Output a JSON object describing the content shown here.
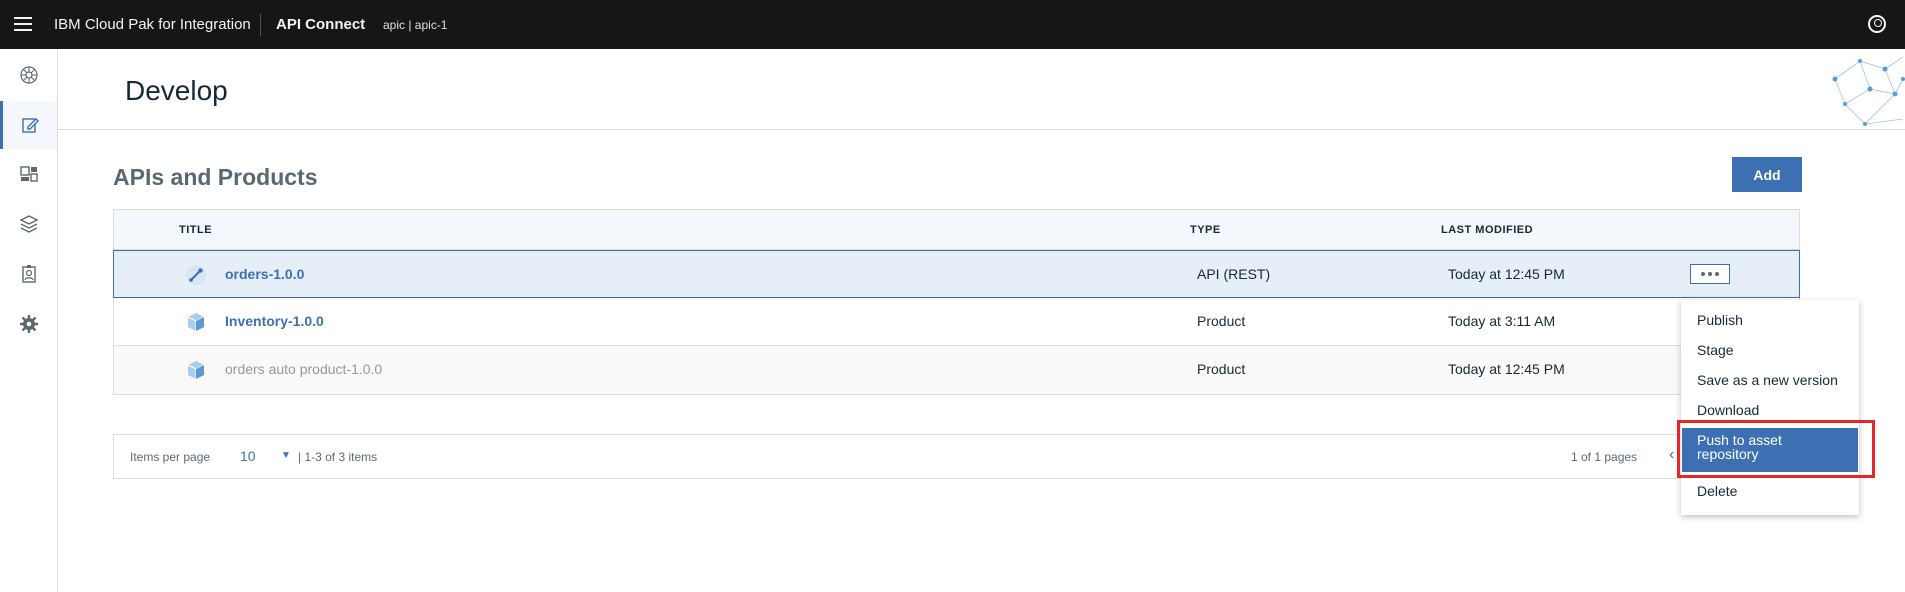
{
  "header": {
    "brand": "IBM Cloud Pak for Integration",
    "product": "API Connect",
    "instance": "apic | apic-1",
    "icons": [
      "menu-icon",
      "user-avatar-icon"
    ]
  },
  "sidenav": {
    "items": [
      {
        "name": "dashboard",
        "icon": "network-icon"
      },
      {
        "name": "develop",
        "icon": "edit-icon",
        "active": true
      },
      {
        "name": "manage",
        "icon": "dashboard-icon"
      },
      {
        "name": "catalogs",
        "icon": "layers-icon"
      },
      {
        "name": "members",
        "icon": "badge-icon"
      },
      {
        "name": "settings",
        "icon": "gear-icon"
      }
    ]
  },
  "page": {
    "title": "Develop",
    "section_title": "APIs and Products",
    "add_label": "Add"
  },
  "table": {
    "columns": [
      "TITLE",
      "TYPE",
      "LAST MODIFIED"
    ],
    "rows": [
      {
        "title": "orders-1.0.0",
        "type": "API (REST)",
        "modified": "Today at 12:45 PM",
        "icon": "api-icon"
      },
      {
        "title": "Inventory-1.0.0",
        "type": "Product",
        "modified": "Today at 3:11 AM",
        "icon": "product-box-icon"
      },
      {
        "title": "orders auto product-1.0.0",
        "type": "Product",
        "modified": "Today at 12:45 PM",
        "icon": "product-box-icon"
      }
    ]
  },
  "pagination": {
    "items_per_page_label": "Items per page",
    "items_per_page_value": "10",
    "range": "|  1-3 of 3 items",
    "pages": "1 of 1 pages"
  },
  "menu": {
    "items": [
      "Publish",
      "Stage",
      "Save as a new version",
      "Download",
      "Push to asset repository",
      "Delete"
    ]
  },
  "colors": {
    "accent": "#3d70b2",
    "topbar": "#161616",
    "highlight_box": "#e8262a"
  }
}
